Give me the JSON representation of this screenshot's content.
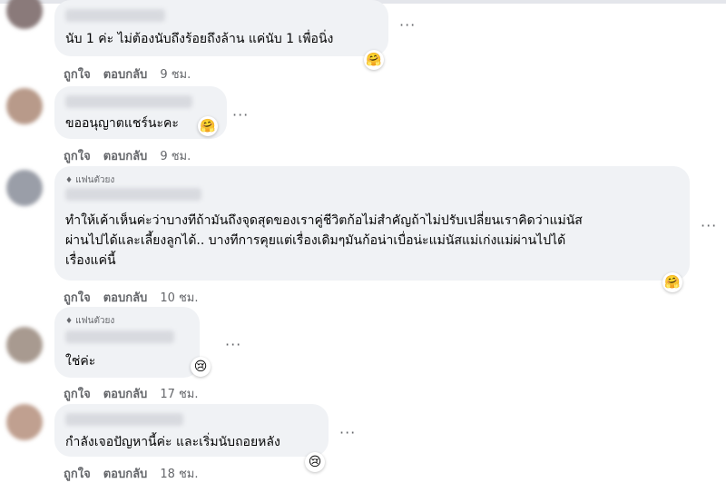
{
  "comments": [
    {
      "badge": "",
      "text": "นับ 1 ค่ะ ไม่ต้องนับถึงร้อยถึงล้าน แค่นับ 1 เพื่อนิ่ง",
      "like_label": "ถูกใจ",
      "reply_label": "ตอบกลับ",
      "time": "9 ชม.",
      "reaction": "care-icon",
      "avatar_color": "#8a7a7a"
    },
    {
      "badge": "",
      "text": "ขออนุญาตแชร์นะคะ",
      "like_label": "ถูกใจ",
      "reply_label": "ตอบกลับ",
      "time": "9 ชม.",
      "reaction": "care-icon",
      "avatar_color": "#b89a8a"
    },
    {
      "badge": "แฟนตัวยง",
      "text_lines": [
        "ทำให้เค้าเห็นค่ะว่าบางทีถ้ามันถึงจุดสุดของเราคู่ชีวิตก้อไม่สำคัญถ้าไม่ปรับเปลี่ยนเราคิดว่าแม่นัส",
        "ผ่านไปได้และเลี้ยงลูกได้.. บางทีการคุยแต่เรื่องเดิมๆมันก้อน่าเบื่อน่ะแม่นัสแม่เก่งแม่ผ่านไปได้",
        "เรื่องแค่นี้"
      ],
      "like_label": "ถูกใจ",
      "reply_label": "ตอบกลับ",
      "time": "10 ชม.",
      "reaction": "care-icon",
      "avatar_color": "#9a9ea8"
    },
    {
      "badge": "แฟนตัวยง",
      "text": "ใช่ค่ะ",
      "like_label": "ถูกใจ",
      "reply_label": "ตอบกลับ",
      "time": "17 ชม.",
      "reaction": "sad-icon",
      "avatar_color": "#a89a90"
    },
    {
      "badge": "",
      "text": "กำลังเจอปัญหานี้ค่ะ และเริ่มนับถอยหลัง",
      "like_label": "ถูกใจ",
      "reply_label": "ตอบกลับ",
      "time": "18 ชม.",
      "reaction": "sad-icon",
      "avatar_color": "#c0a090"
    }
  ],
  "more_icon": "more-dots-icon"
}
